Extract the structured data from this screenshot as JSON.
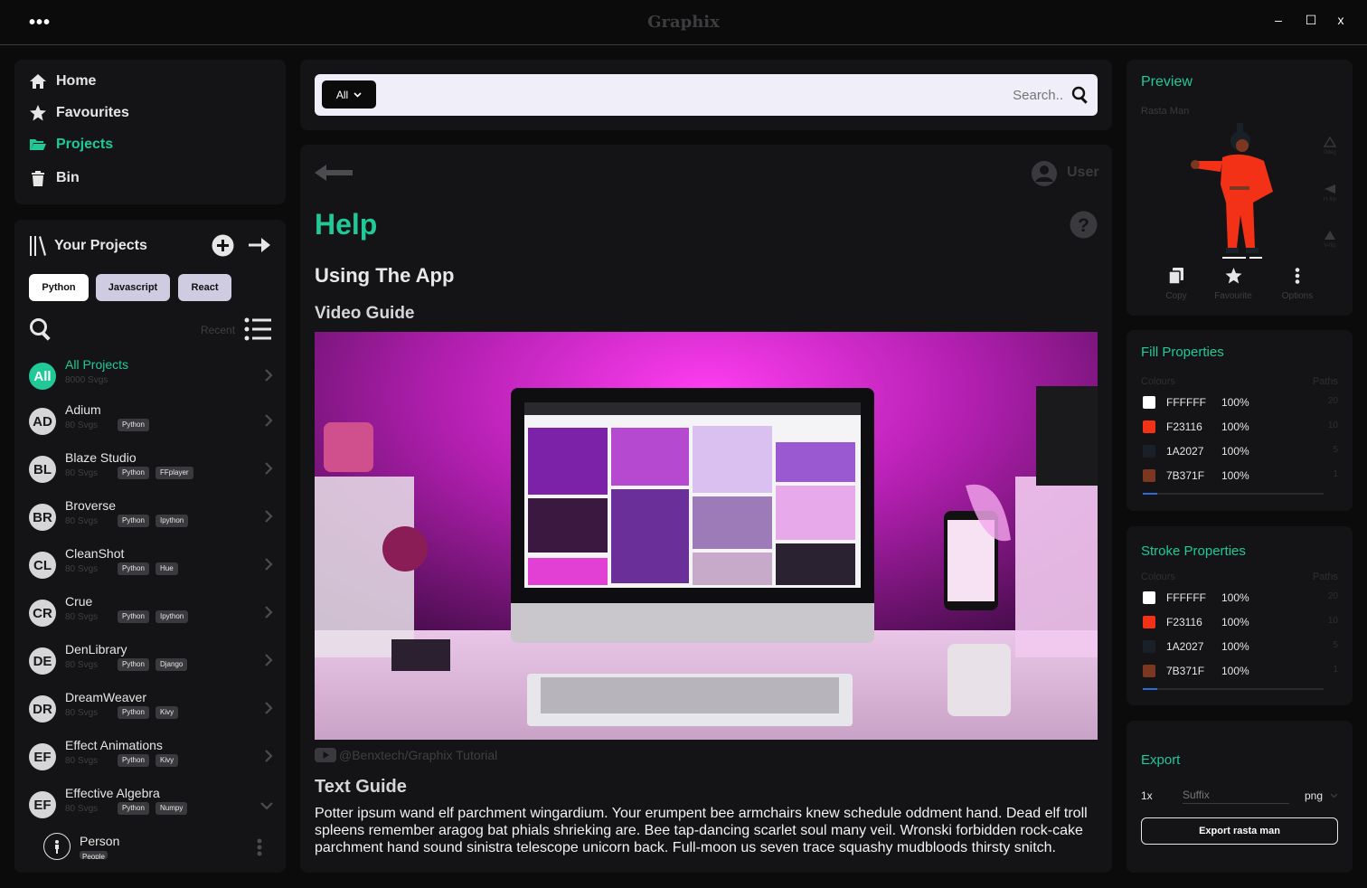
{
  "app": {
    "title": "Graphix",
    "menu_glyph": "•••",
    "minimize": "–",
    "maximize": "☐",
    "close": "x"
  },
  "nav": {
    "items": [
      {
        "label": "Home",
        "icon": "home-icon"
      },
      {
        "label": "Favourites",
        "icon": "star-icon"
      },
      {
        "label": "Projects",
        "icon": "folder-open-icon",
        "active": true
      },
      {
        "label": "Bin",
        "icon": "trash-icon"
      }
    ]
  },
  "projects": {
    "title": "Your Projects",
    "chips": [
      "Python",
      "Javascript",
      "React"
    ],
    "sort_label": "Recent",
    "list": [
      {
        "avatar": "All",
        "name": "All Projects",
        "count": "8000 Svgs",
        "tags": [],
        "highlight": true
      },
      {
        "avatar": "AD",
        "name": "Adium",
        "count": "80 Svgs",
        "tags": [
          "Python"
        ]
      },
      {
        "avatar": "BL",
        "name": "Blaze Studio",
        "count": "80 Svgs",
        "tags": [
          "Python",
          "FFplayer"
        ]
      },
      {
        "avatar": "BR",
        "name": "Broverse",
        "count": "80 Svgs",
        "tags": [
          "Python",
          "Ipython"
        ]
      },
      {
        "avatar": "CL",
        "name": "CleanShot",
        "count": "80 Svgs",
        "tags": [
          "Python",
          "Hue"
        ]
      },
      {
        "avatar": "CR",
        "name": "Crue",
        "count": "80 Svgs",
        "tags": [
          "Python",
          "Ipython"
        ]
      },
      {
        "avatar": "DE",
        "name": "DenLibrary",
        "count": "80 Svgs",
        "tags": [
          "Python",
          "Django"
        ]
      },
      {
        "avatar": "DR",
        "name": "DreamWeaver",
        "count": "80 Svgs",
        "tags": [
          "Python",
          "Kivy"
        ]
      },
      {
        "avatar": "EF",
        "name": "Effect Animations",
        "count": "80 Svgs",
        "tags": [
          "Python",
          "Kivy"
        ]
      },
      {
        "avatar": "EF",
        "name": "Effective Algebra",
        "count": "80 Svgs",
        "tags": [
          "Python",
          "Numpy"
        ],
        "expanded": true
      }
    ],
    "sub_item": {
      "name": "Person",
      "tag": "People"
    }
  },
  "search": {
    "filter": "All",
    "placeholder": "Search.."
  },
  "content": {
    "user_label": "User",
    "title": "Help",
    "section": "Using The App",
    "video_heading": "Video Guide",
    "video_caption": "@Benxtech/Graphix Tutorial",
    "text_heading": "Text Guide",
    "text_body": "Potter ipsum wand elf parchment wingardium. Your erumpent bee armchairs knew schedule oddment hand. Dead elf troll spleens remember aragog bat phials shrieking are. Bee tap-dancing scarlet soul many veil. Wronski forbidden rock-cake parchment hand sound sinistra telescope unicorn back. Full-moon us seven trace squashy mudbloods thirsty snitch."
  },
  "preview": {
    "title": "Preview",
    "name": "Rasta Man",
    "side_tools": [
      {
        "label": "0deg"
      },
      {
        "label": "H-flip"
      },
      {
        "label": "V-flip"
      }
    ],
    "actions": [
      "Copy",
      "Favourite",
      "Options"
    ]
  },
  "fill": {
    "title": "Fill Properties",
    "col_left": "Colours",
    "col_right": "Paths",
    "rows": [
      {
        "color": "#FFFFFF",
        "hex": "FFFFFF",
        "pct": "100%",
        "paths": "20"
      },
      {
        "color": "#F23116",
        "hex": "F23116",
        "pct": "100%",
        "paths": "10"
      },
      {
        "color": "#1A2027",
        "hex": "1A2027",
        "pct": "100%",
        "paths": "5"
      },
      {
        "color": "#7B371F",
        "hex": "7B371F",
        "pct": "100%",
        "paths": "1"
      }
    ]
  },
  "stroke": {
    "title": "Stroke Properties",
    "col_left": "Colours",
    "col_right": "Paths",
    "rows": [
      {
        "color": "#FFFFFF",
        "hex": "FFFFFF",
        "pct": "100%",
        "paths": "20"
      },
      {
        "color": "#F23116",
        "hex": "F23116",
        "pct": "100%",
        "paths": "10"
      },
      {
        "color": "#1A2027",
        "hex": "1A2027",
        "pct": "100%",
        "paths": "5"
      },
      {
        "color": "#7B371F",
        "hex": "7B371F",
        "pct": "100%",
        "paths": "1"
      }
    ]
  },
  "export": {
    "title": "Export",
    "scale": "1x",
    "suffix_placeholder": "Suffix",
    "format": "png",
    "button": "Export rasta man"
  },
  "colors": {
    "accent": "#20C997",
    "panel": "#141416",
    "bg": "#0B0B0C"
  }
}
